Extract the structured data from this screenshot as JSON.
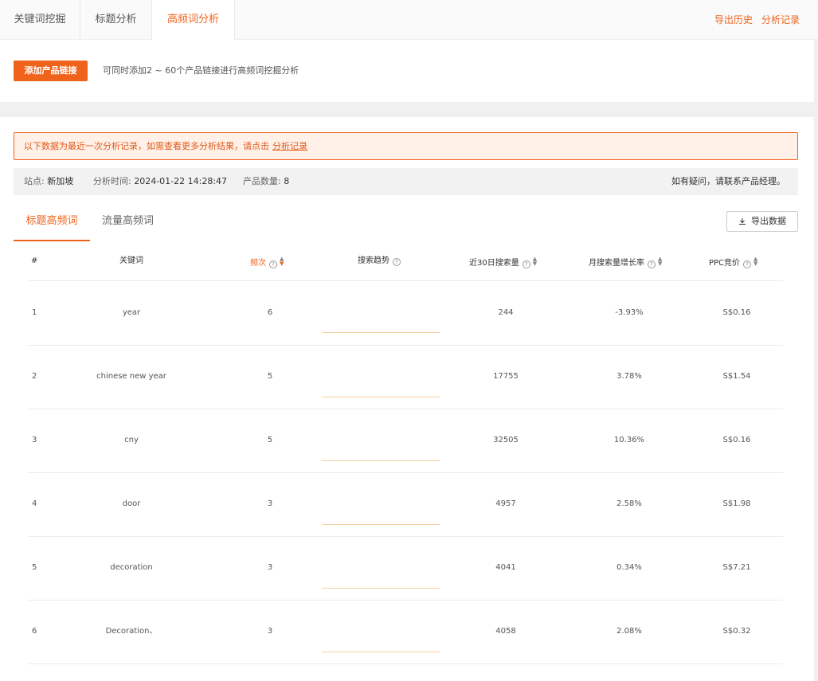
{
  "tabs": [
    "关键词挖掘",
    "标题分析",
    "高频词分析"
  ],
  "header_links": {
    "export_history": "导出历史",
    "analysis_records": "分析记录"
  },
  "add_product": {
    "button_label": "添加产品链接",
    "hint": "可同时添加2 ~ 60个产品链接进行高频词挖掘分析"
  },
  "notice": {
    "text": "以下数据为最近一次分析记录，如需查看更多分析结果，请点击",
    "link": "分析记录"
  },
  "info": {
    "site_label": "站点:",
    "site_value": "新加坡",
    "time_label": "分析时间:",
    "time_value": "2024-01-22 14:28:47",
    "count_label": "产品数量:",
    "count_value": "8",
    "contact": "如有疑问，请联系产品经理。"
  },
  "subtabs": [
    "标题高频词",
    "流量高频词"
  ],
  "export_button": "导出数据",
  "columns": {
    "index": "#",
    "keyword": "关键词",
    "frequency": "频次",
    "trend": "搜索趋势",
    "search_volume": "近30日搜索量",
    "growth": "月搜索量增长率",
    "ppc": "PPC竞价"
  },
  "colors": {
    "accent": "#f0631c",
    "notice_bg": "#fff0e8",
    "trend_line": "#f5cfa4"
  },
  "rows": [
    {
      "index": "1",
      "keyword": "year",
      "frequency": "6",
      "volume": "244",
      "growth": "-3.93%",
      "ppc": "S$0.16"
    },
    {
      "index": "2",
      "keyword": "chinese new year",
      "frequency": "5",
      "volume": "17755",
      "growth": "3.78%",
      "ppc": "S$1.54"
    },
    {
      "index": "3",
      "keyword": "cny",
      "frequency": "5",
      "volume": "32505",
      "growth": "10.36%",
      "ppc": "S$0.16"
    },
    {
      "index": "4",
      "keyword": "door",
      "frequency": "3",
      "volume": "4957",
      "growth": "2.58%",
      "ppc": "S$1.98"
    },
    {
      "index": "5",
      "keyword": "decoration",
      "frequency": "3",
      "volume": "4041",
      "growth": "0.34%",
      "ppc": "S$7.21"
    },
    {
      "index": "6",
      "keyword": "Decoration、",
      "frequency": "3",
      "volume": "4058",
      "growth": "2.08%",
      "ppc": "S$0.32"
    }
  ]
}
